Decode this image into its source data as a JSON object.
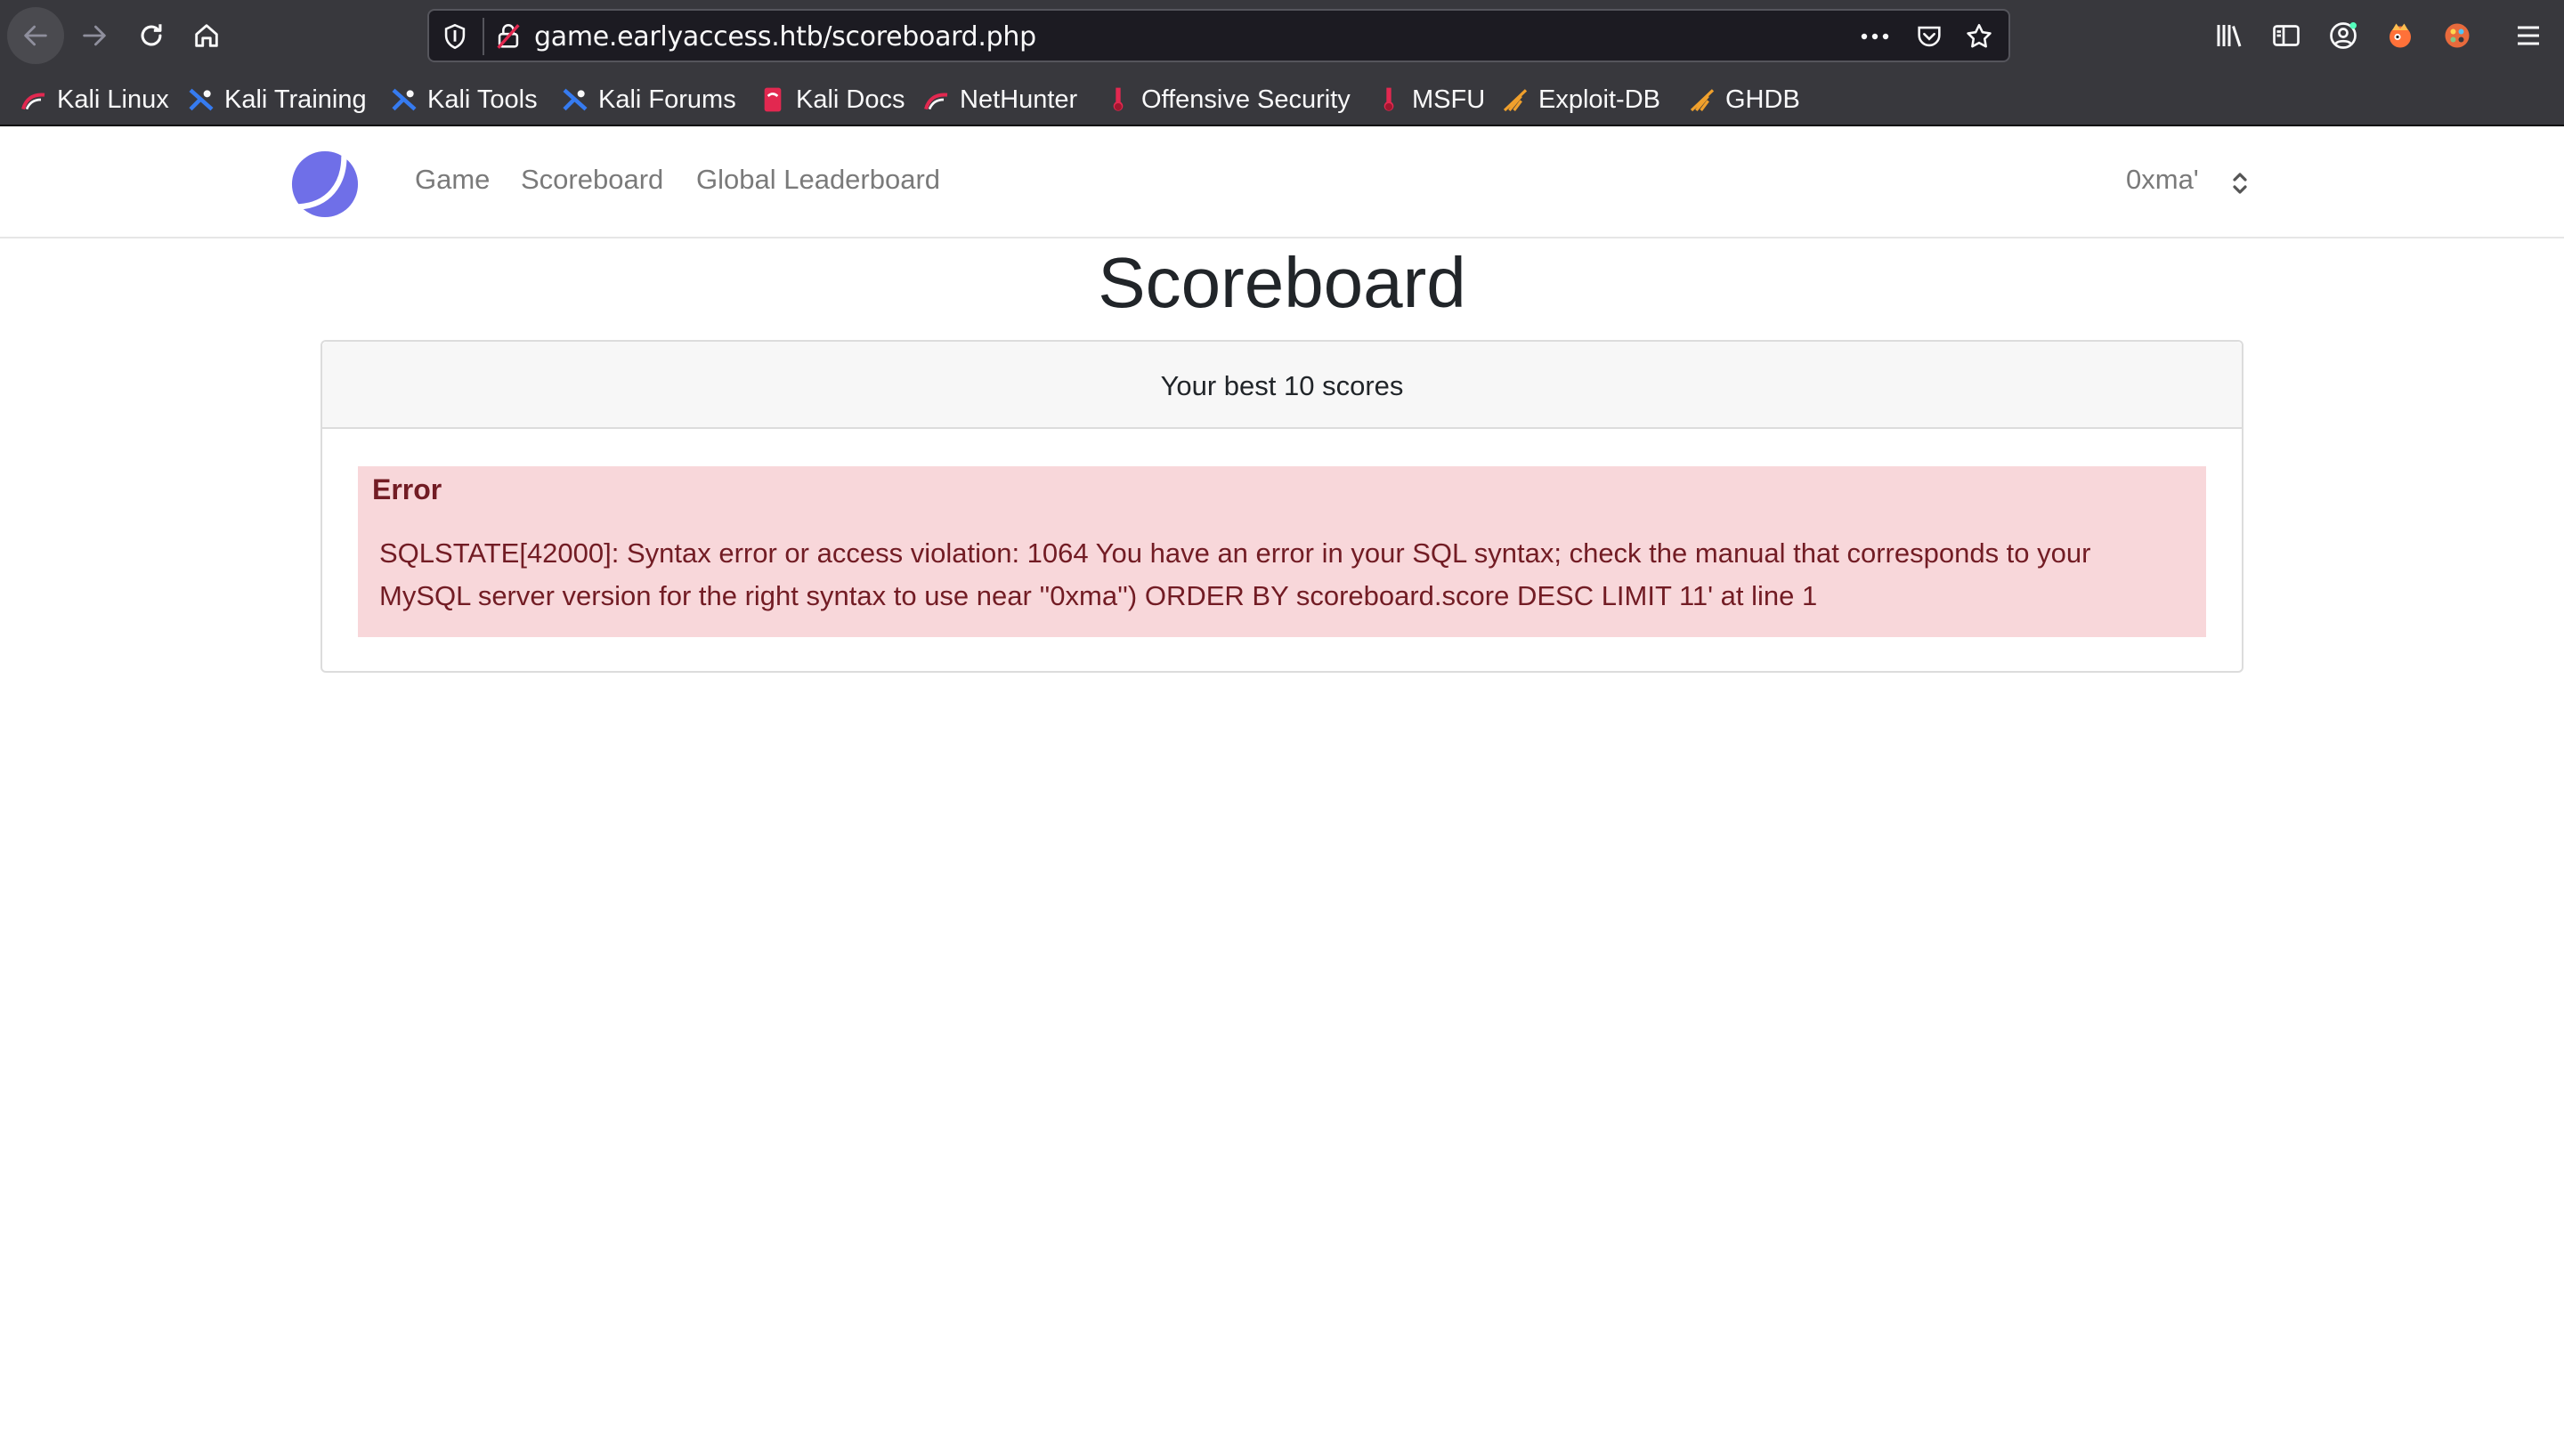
{
  "browser": {
    "url": "game.earlyaccess.htb/scoreboard.php",
    "toolbar_icons": [
      "back-icon",
      "forward-icon",
      "reload-icon",
      "home-icon",
      "shield-icon",
      "insecure-lock-icon",
      "more-dots-icon",
      "pocket-icon",
      "star-icon",
      "library-icon",
      "sidebar-icon",
      "account-icon",
      "extension-icon",
      "extension-icon",
      "hamburger-menu-icon"
    ],
    "bookmarks": [
      {
        "label": "Kali Linux",
        "icon": "kali-icon"
      },
      {
        "label": "Kali Training",
        "icon": "kali-training-icon"
      },
      {
        "label": "Kali Tools",
        "icon": "kali-tools-icon"
      },
      {
        "label": "Kali Forums",
        "icon": "kali-forums-icon"
      },
      {
        "label": "Kali Docs",
        "icon": "kali-docs-icon"
      },
      {
        "label": "NetHunter",
        "icon": "nethunter-icon"
      },
      {
        "label": "Offensive Security",
        "icon": "offsec-icon"
      },
      {
        "label": "MSFU",
        "icon": "msfu-icon"
      },
      {
        "label": "Exploit-DB",
        "icon": "exploitdb-icon"
      },
      {
        "label": "GHDB",
        "icon": "ghdb-icon"
      }
    ]
  },
  "nav": {
    "links": [
      "Game",
      "Scoreboard",
      "Global Leaderboard"
    ],
    "user": "0xma'"
  },
  "page": {
    "title": "Scoreboard",
    "card_header": "Your best 10 scores",
    "error_title": "Error",
    "error_message": "SQLSTATE[42000]: Syntax error or access violation: 1064 You have an error in your SQL syntax; check the manual that corresponds to your MySQL server version for the right syntax to use near ''0xma'') ORDER BY scoreboard.score DESC LIMIT 11' at line 1"
  },
  "colors": {
    "chrome_bg": "#38383d",
    "url_bg": "#1c1b22",
    "logo_accent": "#6f6fe8",
    "error_bg": "#f8d7da",
    "error_text": "#721c24"
  }
}
